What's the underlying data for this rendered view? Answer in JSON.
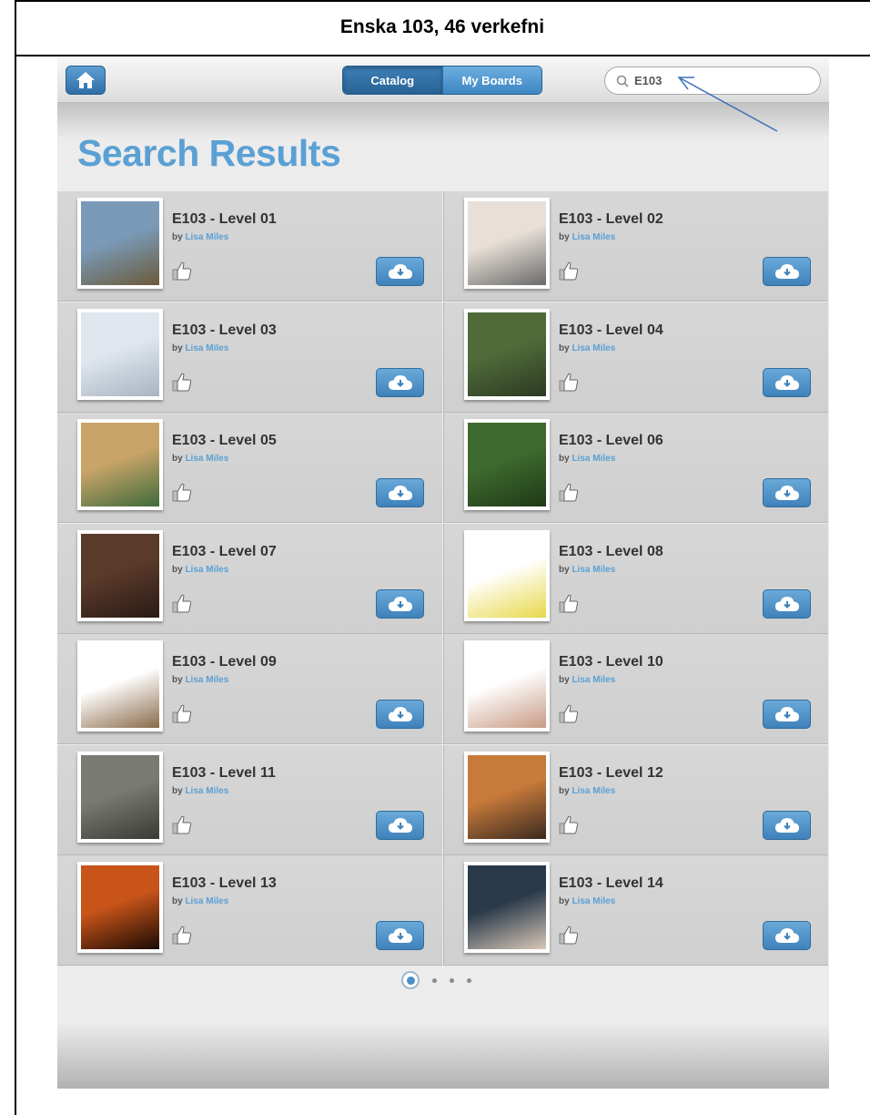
{
  "document": {
    "title": "Enska 103, 46 verkefni"
  },
  "topbar": {
    "tabs": [
      "Catalog",
      "My Boards"
    ],
    "search_value": "E103"
  },
  "page": {
    "heading": "Search Results"
  },
  "results": [
    {
      "title": "E103 - Level 01",
      "by": "by",
      "author": "Lisa Miles"
    },
    {
      "title": "E103 - Level 02",
      "by": "by",
      "author": "Lisa Miles"
    },
    {
      "title": "E103 - Level 03",
      "by": "by",
      "author": "Lisa Miles"
    },
    {
      "title": "E103 - Level 04",
      "by": "by",
      "author": "Lisa Miles"
    },
    {
      "title": "E103 - Level 05",
      "by": "by",
      "author": "Lisa Miles"
    },
    {
      "title": "E103 - Level 06",
      "by": "by",
      "author": "Lisa Miles"
    },
    {
      "title": "E103 - Level 07",
      "by": "by",
      "author": "Lisa Miles"
    },
    {
      "title": "E103 - Level 08",
      "by": "by",
      "author": "Lisa Miles"
    },
    {
      "title": "E103 - Level 09",
      "by": "by",
      "author": "Lisa Miles"
    },
    {
      "title": "E103 - Level 10",
      "by": "by",
      "author": "Lisa Miles"
    },
    {
      "title": "E103 - Level 11",
      "by": "by",
      "author": "Lisa Miles"
    },
    {
      "title": "E103 - Level 12",
      "by": "by",
      "author": "Lisa Miles"
    },
    {
      "title": "E103 - Level 13",
      "by": "by",
      "author": "Lisa Miles"
    },
    {
      "title": "E103 - Level 14",
      "by": "by",
      "author": "Lisa Miles"
    }
  ],
  "pager": {
    "pages": 4,
    "current": 1
  },
  "colors": {
    "accent": "#5aa0d4",
    "button": "#3f82bb"
  }
}
